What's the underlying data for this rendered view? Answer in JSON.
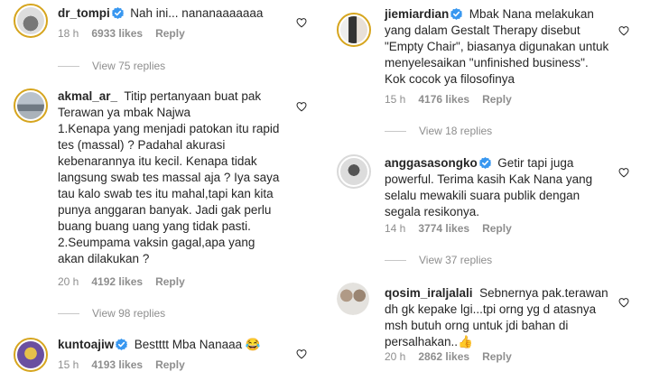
{
  "left": [
    {
      "username": "dr_tompi",
      "verified": true,
      "text": "Nah ini... nananaaaaaaa",
      "time": "18 h",
      "likes": "6933 likes",
      "reply": "Reply",
      "view_replies": "View 75 replies"
    },
    {
      "username": "akmal_ar_",
      "verified": false,
      "text": "Titip pertanyaan buat pak Terawan ya mbak Najwa\n1.Kenapa yang menjadi patokan itu rapid tes (massal) ? Padahal akurasi kebenarannya itu kecil. Kenapa tidak langsung swab tes massal aja ? Iya saya tau kalo swab tes itu mahal,tapi kan kita punya anggaran banyak. Jadi gak perlu buang buang uang yang tidak pasti.\n2.Seumpama vaksin gagal,apa yang akan dilakukan ?",
      "time": "20 h",
      "likes": "4192 likes",
      "reply": "Reply",
      "view_replies": "View 98 replies"
    },
    {
      "username": "kuntoajiw",
      "verified": true,
      "text": "Bestttt Mba Nanaaa 😂",
      "time": "15 h",
      "likes": "4193 likes",
      "reply": "Reply"
    }
  ],
  "right": [
    {
      "username": "jiemiardian",
      "verified": true,
      "text": "Mbak Nana melakukan yang dalam Gestalt Therapy disebut \"Empty Chair\", biasanya digunakan untuk menyelesaikan \"unfinished business\". Kok cocok ya filosofinya",
      "time": "15 h",
      "likes": "4176 likes",
      "reply": "Reply",
      "view_replies": "View 18 replies"
    },
    {
      "username": "anggasasongko",
      "verified": true,
      "text": "Getir tapi juga powerful. Terima kasih Kak Nana yang selalu mewakili suara publik dengan segala resikonya.",
      "time": "14 h",
      "likes": "3774 likes",
      "reply": "Reply",
      "view_replies": "View 37 replies"
    },
    {
      "username": "qosim_iraljalali",
      "verified": false,
      "text": "Sebnernya pak.terawan dh gk kepake lgi...tpi orng yg d atasnya msh butuh orng untuk jdi bahan di persalhakan..👍",
      "time": "20 h",
      "likes": "2862 likes",
      "reply": "Reply"
    }
  ],
  "colors": {
    "verified": "#3897f0",
    "meta": "#8e8e8e",
    "ring": "#d6a51e"
  }
}
